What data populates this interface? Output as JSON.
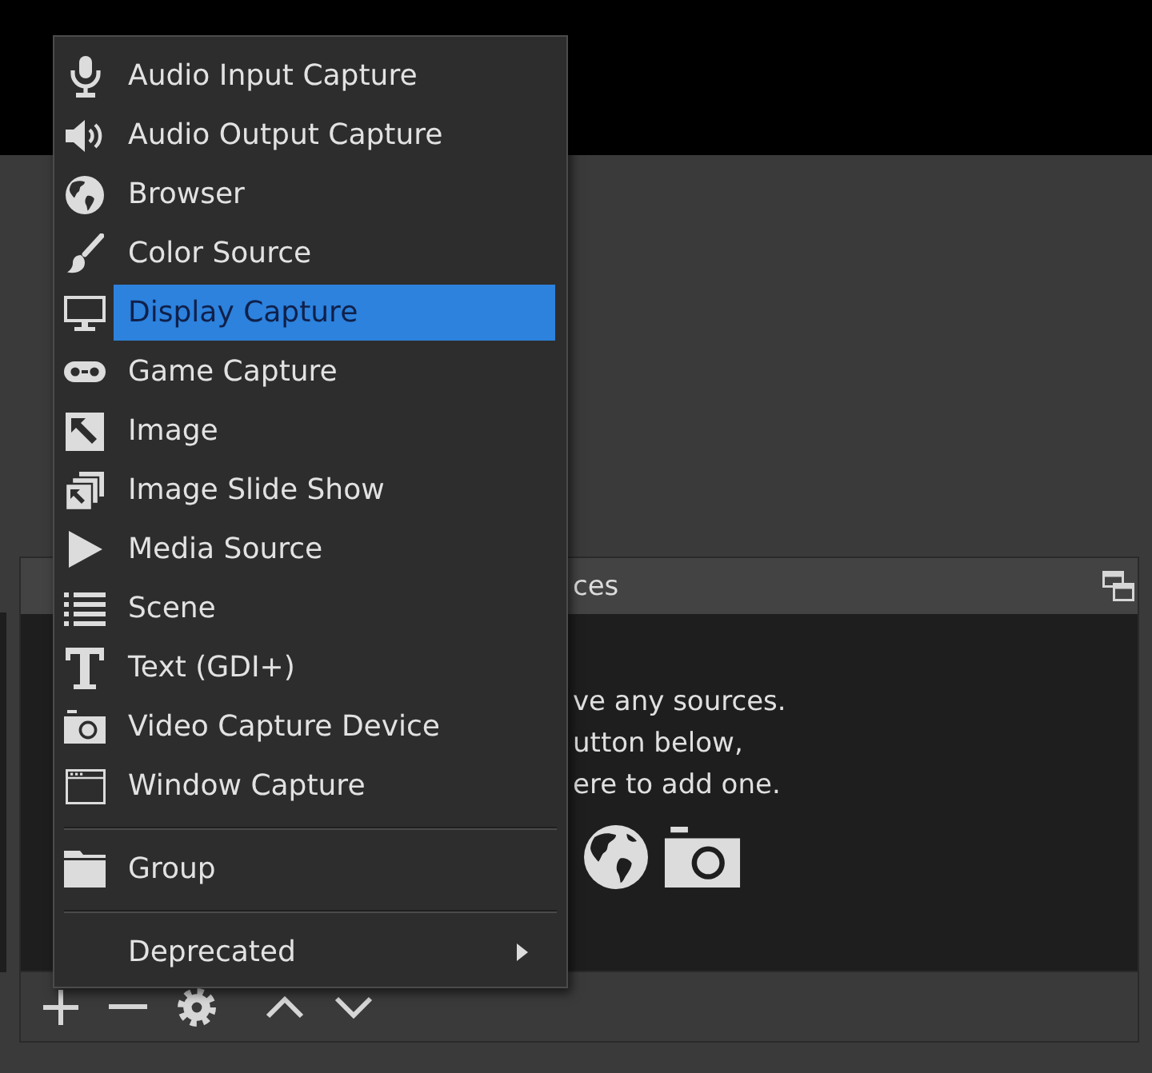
{
  "menu": {
    "sections": [
      {
        "items": [
          {
            "kind": "action",
            "label": "Audio Input Capture",
            "selected": false
          },
          {
            "kind": "action",
            "label": "Audio Output Capture",
            "selected": false
          },
          {
            "kind": "action",
            "label": "Browser",
            "selected": false
          },
          {
            "kind": "action",
            "label": "Color Source",
            "selected": false
          },
          {
            "kind": "action",
            "label": "Display Capture",
            "selected": true
          },
          {
            "kind": "action",
            "label": "Game Capture",
            "selected": false
          },
          {
            "kind": "action",
            "label": "Image",
            "selected": false
          },
          {
            "kind": "action",
            "label": "Image Slide Show",
            "selected": false
          },
          {
            "kind": "action",
            "label": "Media Source",
            "selected": false
          },
          {
            "kind": "action",
            "label": "Scene",
            "selected": false
          },
          {
            "kind": "action",
            "label": "Text (GDI+)",
            "selected": false
          },
          {
            "kind": "action",
            "label": "Video Capture Device",
            "selected": false
          },
          {
            "kind": "action",
            "label": "Window Capture",
            "selected": false
          }
        ]
      },
      {
        "items": [
          {
            "kind": "action",
            "label": "Group",
            "selected": false
          }
        ]
      },
      {
        "items": [
          {
            "kind": "submenu",
            "label": "Deprecated",
            "selected": false
          }
        ]
      }
    ]
  },
  "sources_panel": {
    "title": "ces",
    "empty_message": [
      "ve any sources.",
      "utton below,",
      "ere to add one."
    ]
  }
}
